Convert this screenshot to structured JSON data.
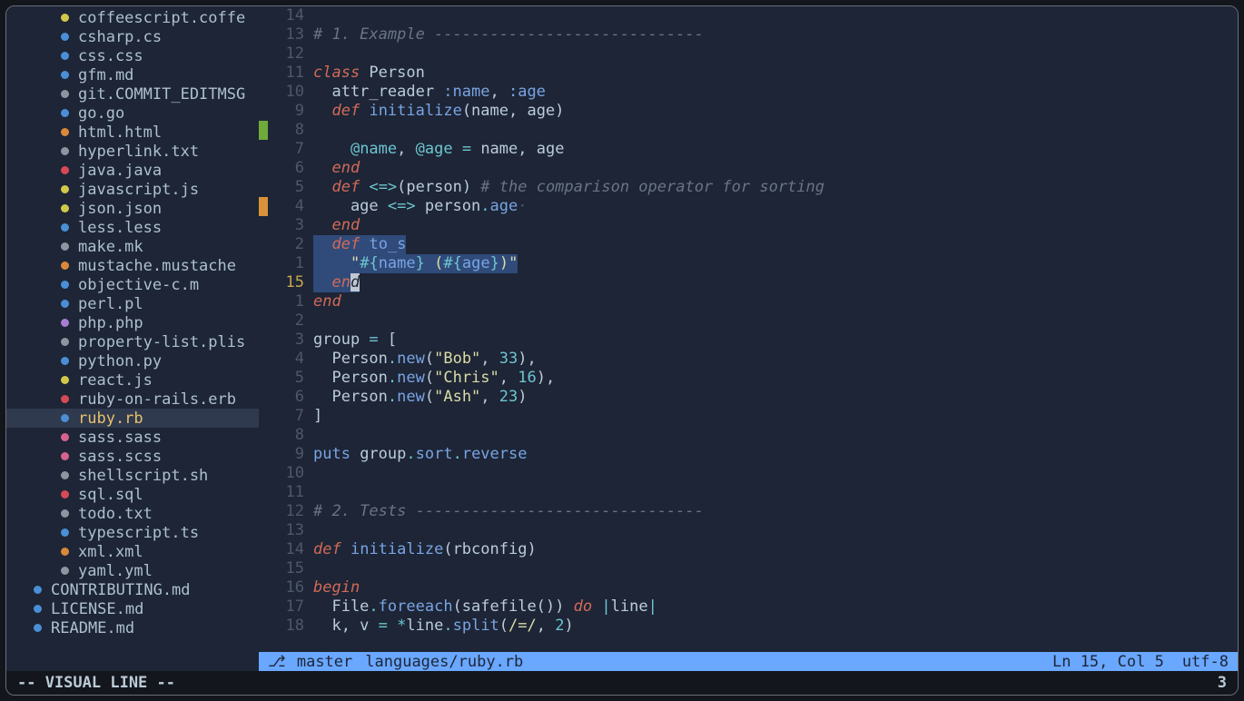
{
  "colors": {
    "yellow": "#d1c84a",
    "blue": "#4a8fd6",
    "grey": "#8d96a0",
    "orange": "#d9883a",
    "red": "#d64955",
    "green": "#7aba3b",
    "cyan": "#4abec5",
    "purple": "#a97dd3",
    "pink": "#d6638f"
  },
  "sidebar": {
    "files": [
      {
        "dot": "yellow",
        "name": "coffeescript.coffe",
        "depth": 2
      },
      {
        "dot": "blue",
        "name": "csharp.cs",
        "depth": 2
      },
      {
        "dot": "blue",
        "name": "css.css",
        "depth": 2
      },
      {
        "dot": "blue",
        "name": "gfm.md",
        "depth": 2
      },
      {
        "dot": "grey",
        "name": "git.COMMIT_EDITMSG",
        "depth": 2
      },
      {
        "dot": "blue",
        "name": "go.go",
        "depth": 2
      },
      {
        "dot": "orange",
        "name": "html.html",
        "depth": 2
      },
      {
        "dot": "grey",
        "name": "hyperlink.txt",
        "depth": 2
      },
      {
        "dot": "red",
        "name": "java.java",
        "depth": 2
      },
      {
        "dot": "yellow",
        "name": "javascript.js",
        "depth": 2
      },
      {
        "dot": "yellow",
        "name": "json.json",
        "depth": 2
      },
      {
        "dot": "blue",
        "name": "less.less",
        "depth": 2
      },
      {
        "dot": "grey",
        "name": "make.mk",
        "depth": 2
      },
      {
        "dot": "orange",
        "name": "mustache.mustache",
        "depth": 2
      },
      {
        "dot": "blue",
        "name": "objective-c.m",
        "depth": 2
      },
      {
        "dot": "blue",
        "name": "perl.pl",
        "depth": 2
      },
      {
        "dot": "purple",
        "name": "php.php",
        "depth": 2
      },
      {
        "dot": "grey",
        "name": "property-list.plis",
        "depth": 2
      },
      {
        "dot": "blue",
        "name": "python.py",
        "depth": 2
      },
      {
        "dot": "yellow",
        "name": "react.js",
        "depth": 2
      },
      {
        "dot": "red",
        "name": "ruby-on-rails.erb",
        "depth": 2
      },
      {
        "dot": "blue",
        "name": "ruby.rb",
        "depth": 2,
        "selected": true
      },
      {
        "dot": "pink",
        "name": "sass.sass",
        "depth": 2
      },
      {
        "dot": "pink",
        "name": "sass.scss",
        "depth": 2
      },
      {
        "dot": "grey",
        "name": "shellscript.sh",
        "depth": 2
      },
      {
        "dot": "red",
        "name": "sql.sql",
        "depth": 2
      },
      {
        "dot": "grey",
        "name": "todo.txt",
        "depth": 2
      },
      {
        "dot": "blue",
        "name": "typescript.ts",
        "depth": 2
      },
      {
        "dot": "orange",
        "name": "xml.xml",
        "depth": 2
      },
      {
        "dot": "grey",
        "name": "yaml.yml",
        "depth": 2
      },
      {
        "dot": "blue",
        "name": "CONTRIBUTING.md",
        "depth": 1
      },
      {
        "dot": "blue",
        "name": "LICENSE.md",
        "depth": 1
      },
      {
        "dot": "blue",
        "name": "README.md",
        "depth": 1
      }
    ]
  },
  "editor": {
    "lines": [
      {
        "n": "14",
        "t": []
      },
      {
        "n": "13",
        "t": [
          {
            "c": "tok-comment",
            "s": "# 1. Example -----------------------------"
          }
        ]
      },
      {
        "n": "12",
        "t": []
      },
      {
        "n": "11",
        "t": [
          {
            "c": "tok-kw",
            "s": "class"
          },
          {
            "c": "tok-plain",
            "s": " Person"
          }
        ]
      },
      {
        "n": "10",
        "t": [
          {
            "c": "tok-plain",
            "s": "  attr_reader "
          },
          {
            "c": "tok-sym",
            "s": ":name"
          },
          {
            "c": "tok-plain",
            "s": ", "
          },
          {
            "c": "tok-sym",
            "s": ":age"
          }
        ]
      },
      {
        "n": "9",
        "t": [
          {
            "c": "tok-plain",
            "s": "  "
          },
          {
            "c": "tok-kw",
            "s": "def"
          },
          {
            "c": "tok-plain",
            "s": " "
          },
          {
            "c": "tok-fn",
            "s": "initialize"
          },
          {
            "c": "tok-plain",
            "s": "(name, age)"
          }
        ]
      },
      {
        "n": "8",
        "gmark": "green",
        "t": []
      },
      {
        "n": "7",
        "t": [
          {
            "c": "tok-plain",
            "s": "    "
          },
          {
            "c": "tok-var",
            "s": "@name"
          },
          {
            "c": "tok-plain",
            "s": ", "
          },
          {
            "c": "tok-var",
            "s": "@age"
          },
          {
            "c": "tok-plain",
            "s": " "
          },
          {
            "c": "tok-op",
            "s": "="
          },
          {
            "c": "tok-plain",
            "s": " name, age"
          }
        ]
      },
      {
        "n": "6",
        "t": [
          {
            "c": "tok-plain",
            "s": "  "
          },
          {
            "c": "tok-kw",
            "s": "end"
          }
        ]
      },
      {
        "n": "5",
        "t": [
          {
            "c": "tok-plain",
            "s": "  "
          },
          {
            "c": "tok-kw",
            "s": "def"
          },
          {
            "c": "tok-plain",
            "s": " "
          },
          {
            "c": "tok-op",
            "s": "<=>"
          },
          {
            "c": "tok-plain",
            "s": "(person) "
          },
          {
            "c": "tok-comment",
            "s": "# the comparison operator for sorting"
          }
        ]
      },
      {
        "n": "4",
        "gmark": "orange",
        "t": [
          {
            "c": "tok-plain",
            "s": "    age "
          },
          {
            "c": "tok-op",
            "s": "<=>"
          },
          {
            "c": "tok-plain",
            "s": " person"
          },
          {
            "c": "tok-op",
            "s": "."
          },
          {
            "c": "tok-fn",
            "s": "age"
          },
          {
            "c": "tok-dim",
            "s": "·"
          }
        ]
      },
      {
        "n": "3",
        "t": [
          {
            "c": "tok-plain",
            "s": "  "
          },
          {
            "c": "tok-kw",
            "s": "end"
          }
        ]
      },
      {
        "n": "2",
        "sel": true,
        "t": [
          {
            "c": "tok-plain",
            "s": "  "
          },
          {
            "c": "tok-kw",
            "s": "def"
          },
          {
            "c": "tok-plain",
            "s": " "
          },
          {
            "c": "tok-fn",
            "s": "to_s"
          }
        ]
      },
      {
        "n": "1",
        "sel": true,
        "t": [
          {
            "c": "tok-plain",
            "s": "    "
          },
          {
            "c": "tok-str",
            "s": "\""
          },
          {
            "c": "tok-op",
            "s": "#{"
          },
          {
            "c": "tok-fn",
            "s": "name"
          },
          {
            "c": "tok-op",
            "s": "}"
          },
          {
            "c": "tok-str",
            "s": " ("
          },
          {
            "c": "tok-op",
            "s": "#{"
          },
          {
            "c": "tok-fn",
            "s": "age"
          },
          {
            "c": "tok-op",
            "s": "}"
          },
          {
            "c": "tok-str",
            "s": ")\""
          }
        ]
      },
      {
        "n": "15",
        "current": true,
        "selPartial": true,
        "t": [
          {
            "c": "tok-plain",
            "s": "  "
          },
          {
            "c": "tok-kw",
            "s": "en"
          },
          {
            "c": "tok-kw cursor",
            "s": "d"
          }
        ]
      },
      {
        "n": "1",
        "t": [
          {
            "c": "tok-kw",
            "s": "end"
          }
        ]
      },
      {
        "n": "2",
        "t": []
      },
      {
        "n": "3",
        "t": [
          {
            "c": "tok-plain",
            "s": "group "
          },
          {
            "c": "tok-op",
            "s": "="
          },
          {
            "c": "tok-plain",
            "s": " ["
          }
        ]
      },
      {
        "n": "4",
        "t": [
          {
            "c": "tok-plain",
            "s": "  Person"
          },
          {
            "c": "tok-op",
            "s": "."
          },
          {
            "c": "tok-fn",
            "s": "new"
          },
          {
            "c": "tok-plain",
            "s": "("
          },
          {
            "c": "tok-str",
            "s": "\"Bob\""
          },
          {
            "c": "tok-plain",
            "s": ", "
          },
          {
            "c": "tok-num",
            "s": "33"
          },
          {
            "c": "tok-plain",
            "s": "),"
          }
        ]
      },
      {
        "n": "5",
        "t": [
          {
            "c": "tok-plain",
            "s": "  Person"
          },
          {
            "c": "tok-op",
            "s": "."
          },
          {
            "c": "tok-fn",
            "s": "new"
          },
          {
            "c": "tok-plain",
            "s": "("
          },
          {
            "c": "tok-str",
            "s": "\"Chris\""
          },
          {
            "c": "tok-plain",
            "s": ", "
          },
          {
            "c": "tok-num",
            "s": "16"
          },
          {
            "c": "tok-plain",
            "s": "),"
          }
        ]
      },
      {
        "n": "6",
        "t": [
          {
            "c": "tok-plain",
            "s": "  Person"
          },
          {
            "c": "tok-op",
            "s": "."
          },
          {
            "c": "tok-fn",
            "s": "new"
          },
          {
            "c": "tok-plain",
            "s": "("
          },
          {
            "c": "tok-str",
            "s": "\"Ash\""
          },
          {
            "c": "tok-plain",
            "s": ", "
          },
          {
            "c": "tok-num",
            "s": "23"
          },
          {
            "c": "tok-plain",
            "s": ")"
          }
        ]
      },
      {
        "n": "7",
        "t": [
          {
            "c": "tok-plain",
            "s": "]"
          }
        ]
      },
      {
        "n": "8",
        "t": []
      },
      {
        "n": "9",
        "t": [
          {
            "c": "tok-fn",
            "s": "puts"
          },
          {
            "c": "tok-plain",
            "s": " group"
          },
          {
            "c": "tok-op",
            "s": "."
          },
          {
            "c": "tok-fn",
            "s": "sort"
          },
          {
            "c": "tok-op",
            "s": "."
          },
          {
            "c": "tok-fn",
            "s": "reverse"
          }
        ]
      },
      {
        "n": "10",
        "t": []
      },
      {
        "n": "11",
        "t": []
      },
      {
        "n": "12",
        "t": [
          {
            "c": "tok-comment",
            "s": "# 2. Tests -------------------------------"
          }
        ]
      },
      {
        "n": "13",
        "t": []
      },
      {
        "n": "14",
        "t": [
          {
            "c": "tok-kw",
            "s": "def"
          },
          {
            "c": "tok-plain",
            "s": " "
          },
          {
            "c": "tok-fn",
            "s": "initialize"
          },
          {
            "c": "tok-plain",
            "s": "(rbconfig)"
          }
        ]
      },
      {
        "n": "15",
        "t": []
      },
      {
        "n": "16",
        "t": [
          {
            "c": "tok-kw",
            "s": "begin"
          }
        ]
      },
      {
        "n": "17",
        "t": [
          {
            "c": "tok-plain",
            "s": "  File"
          },
          {
            "c": "tok-op",
            "s": "."
          },
          {
            "c": "tok-fn",
            "s": "foreeach"
          },
          {
            "c": "tok-plain",
            "s": "(safefile()) "
          },
          {
            "c": "tok-kw",
            "s": "do"
          },
          {
            "c": "tok-plain",
            "s": " "
          },
          {
            "c": "tok-op",
            "s": "|"
          },
          {
            "c": "tok-plain",
            "s": "line"
          },
          {
            "c": "tok-op",
            "s": "|"
          }
        ]
      },
      {
        "n": "18",
        "t": [
          {
            "c": "tok-plain",
            "s": "  k, v "
          },
          {
            "c": "tok-op",
            "s": "="
          },
          {
            "c": "tok-plain",
            "s": " "
          },
          {
            "c": "tok-op",
            "s": "*"
          },
          {
            "c": "tok-plain",
            "s": "line"
          },
          {
            "c": "tok-op",
            "s": "."
          },
          {
            "c": "tok-fn",
            "s": "split"
          },
          {
            "c": "tok-plain",
            "s": "("
          },
          {
            "c": "tok-str",
            "s": "/=/"
          },
          {
            "c": "tok-plain",
            "s": ", "
          },
          {
            "c": "tok-num",
            "s": "2"
          },
          {
            "c": "tok-plain",
            "s": ")"
          }
        ]
      }
    ]
  },
  "status": {
    "branch_icon": "⎇",
    "branch": "master",
    "path": "languages/ruby.rb",
    "position": "Ln 15, Col 5",
    "encoding": "utf-8"
  },
  "bottom": {
    "mode": "-- VISUAL LINE --",
    "count": "3"
  }
}
